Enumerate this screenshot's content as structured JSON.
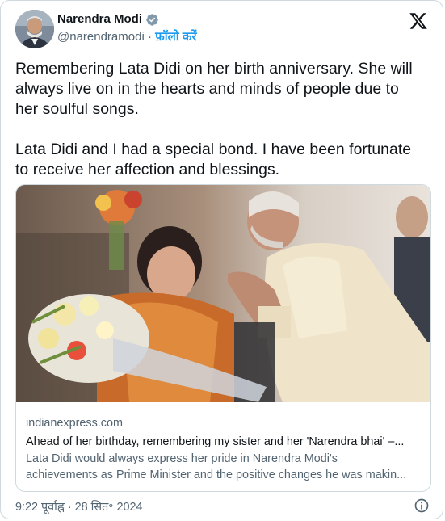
{
  "author": {
    "name": "Narendra Modi",
    "handle": "@narendramodi",
    "separator": "·",
    "follow_label": "फ़ॉलो करें",
    "verified_color": "#829aab"
  },
  "icons": {
    "platform": "x-logo-icon",
    "verified": "verified-badge-icon",
    "info": "info-icon"
  },
  "tweet": {
    "paragraph1": [
      "Remembering Lata Didi on her birth anniversary. She will",
      "always live on in the hearts and minds of people due to",
      "her soulful songs."
    ],
    "paragraph2": [
      "Lata Didi and I had a special bond. I have been fortunate",
      "to receive her affection and blessings."
    ]
  },
  "link_card": {
    "domain": "indianexpress.com",
    "title": "Ahead of her birthday, remembering my sister and her 'Narendra bhai' –...",
    "description": [
      "Lata Didi would always express her pride in Narendra Modi's",
      "achievements as Prime Minister and the positive changes he was makin..."
    ]
  },
  "footer": {
    "timestamp": "9:22 पूर्वाह्न · 28 सित॰ 2024"
  },
  "colors": {
    "text_primary": "#0f1419",
    "text_secondary": "#536471",
    "accent": "#1d9bf0",
    "border": "#cfd9de"
  }
}
